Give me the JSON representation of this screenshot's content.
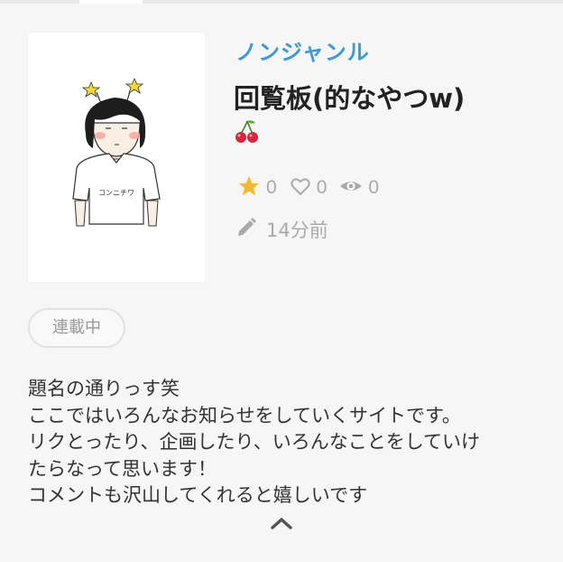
{
  "novel": {
    "genre": "ノンジャンル",
    "title": "回覧板(的なやつw)",
    "subtitle_emoji": "🍒",
    "cover_text": "コンニチワ",
    "stats": {
      "stars": "0",
      "likes": "0",
      "views": "0"
    },
    "updated": "14分前",
    "status_badge": "連載中",
    "description": [
      "題名の通りっす笑",
      "ここではいろんなお知らせをしていくサイトです。",
      "リクとったり、企画したり、いろんなことをしていけ",
      "たらなって思います！",
      "コメントも沢山してくれると嬉しいです"
    ]
  },
  "icons": {
    "star": "star-icon",
    "heart": "heart-icon",
    "eye": "eye-icon",
    "pencil": "pencil-icon",
    "collapse": "chevron-up-icon"
  },
  "colors": {
    "genre": "#3d9ad6",
    "star": "#f5b82e",
    "muted": "#aaaaaa",
    "cherry": "#d7263d"
  }
}
